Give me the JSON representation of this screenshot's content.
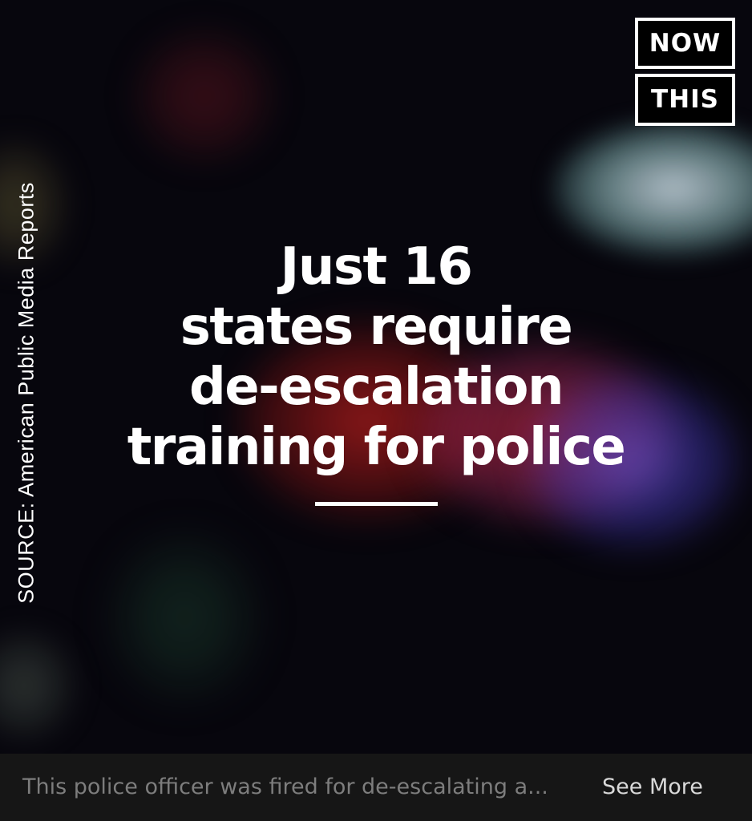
{
  "logo": {
    "line1": "NOW",
    "line2": "THIS"
  },
  "source_label": "SOURCE: American Public Media Reports",
  "headline": {
    "lines": [
      "Just 16",
      "states require",
      "de-escalation",
      "training for police"
    ]
  },
  "caption": {
    "text": "This police officer was fired for de-escalating a...",
    "see_more": "See More"
  },
  "colors": {
    "background": "#07060d",
    "caption_bar": "#161616",
    "caption_text": "#7d7d7d",
    "see_more": "#d9d9d9",
    "headline": "#ffffff"
  }
}
